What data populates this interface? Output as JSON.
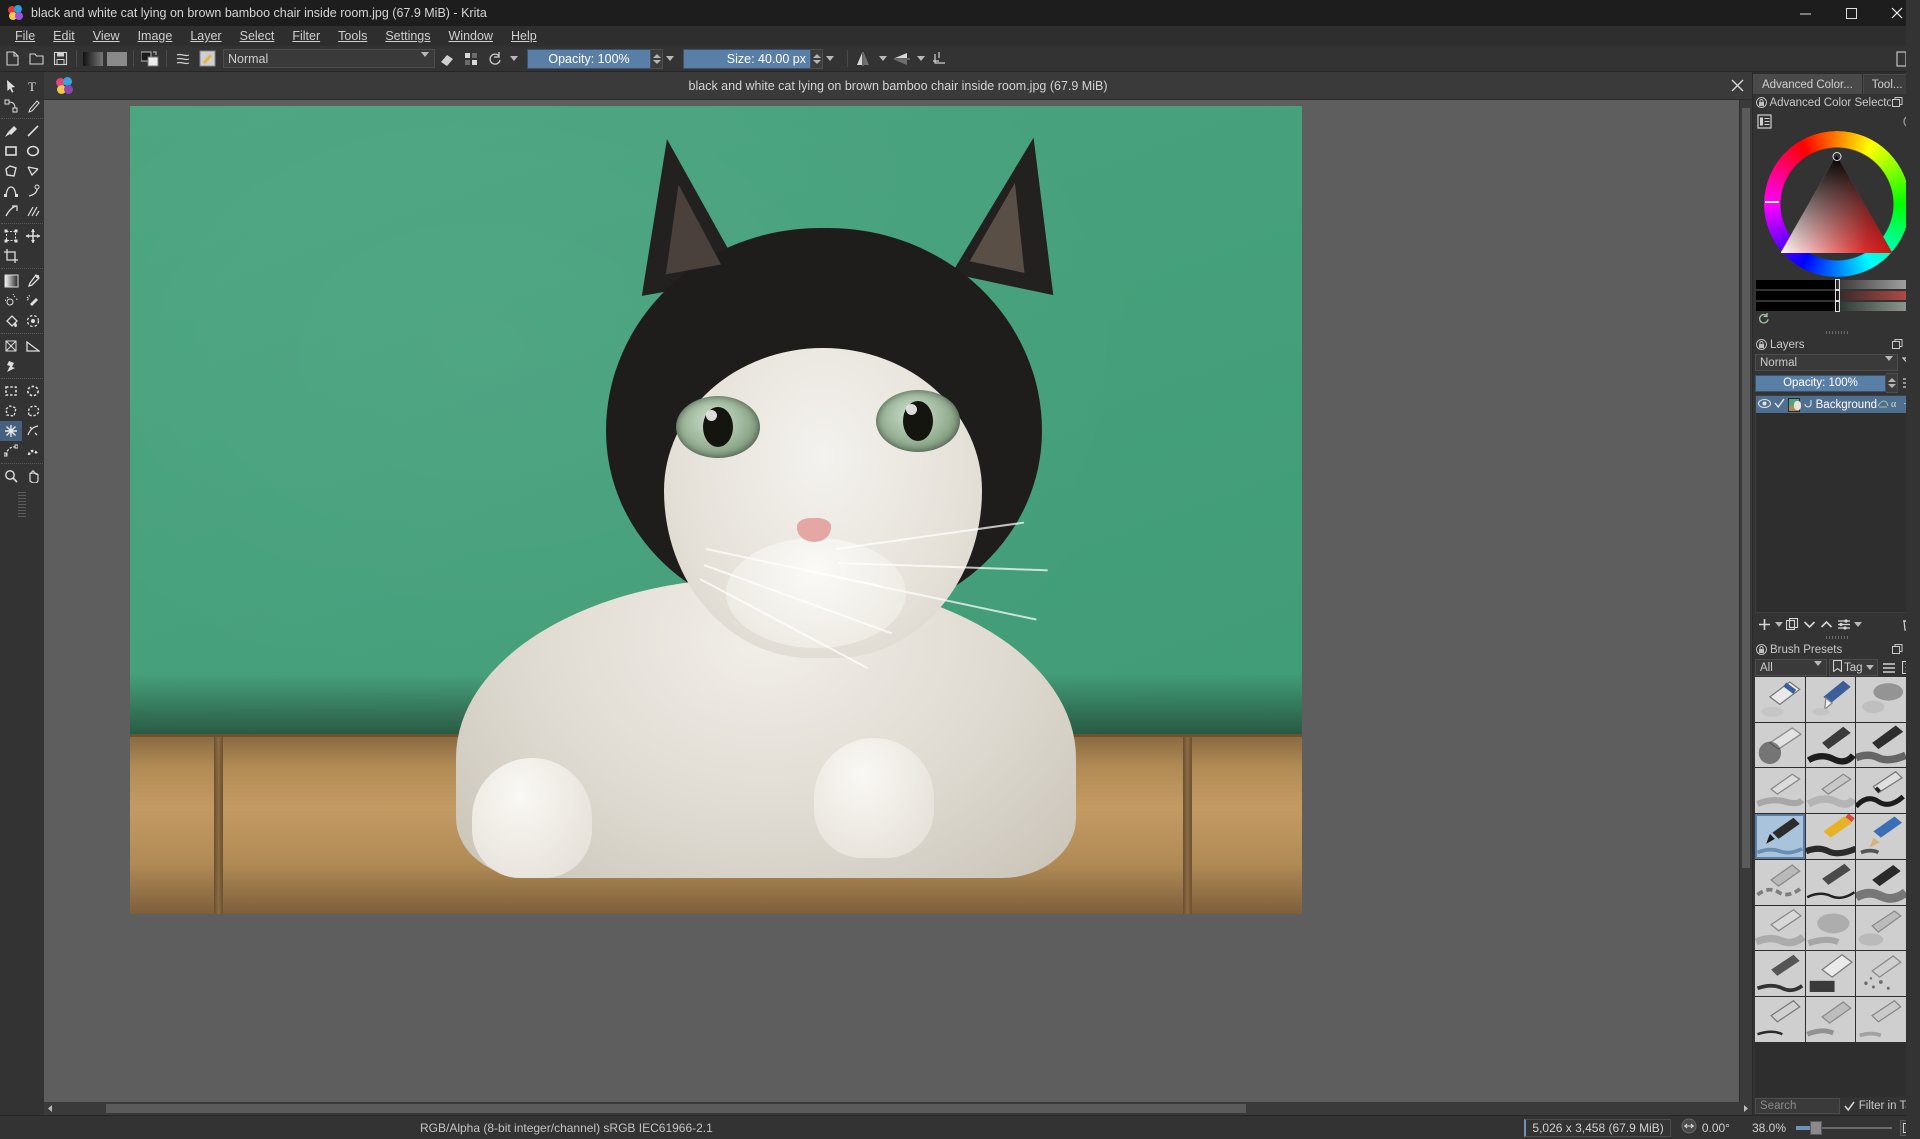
{
  "window": {
    "title": "black and white cat lying on brown bamboo chair inside room.jpg (67.9 MiB)  - Krita",
    "app_icon": "krita-logo-icon",
    "controls": {
      "minimize": "minimize-icon",
      "maximize": "maximize-icon",
      "close": "close-icon"
    }
  },
  "menubar": {
    "items": [
      {
        "label": "File"
      },
      {
        "label": "Edit"
      },
      {
        "label": "View"
      },
      {
        "label": "Image"
      },
      {
        "label": "Layer"
      },
      {
        "label": "Select"
      },
      {
        "label": "Filter"
      },
      {
        "label": "Tools"
      },
      {
        "label": "Settings"
      },
      {
        "label": "Window"
      },
      {
        "label": "Help"
      }
    ]
  },
  "toolbar": {
    "buttons": [
      {
        "name": "new-file-icon"
      },
      {
        "name": "open-file-icon"
      },
      {
        "name": "save-file-icon"
      },
      {
        "name": "gradient-icon"
      },
      {
        "name": "pattern-icon"
      },
      {
        "name": "fg-bg-color-icon"
      },
      {
        "name": "brush-editor-icon"
      },
      {
        "name": "brush-preset-icon"
      }
    ],
    "blending_mode": {
      "value": "Normal",
      "arrow": "chevron-down-icon"
    },
    "eraser_icon": "eraser-icon",
    "alpha_icon": "alpha-lock-icon",
    "reload_icon": "reload-preset-icon",
    "reload_arrow": "chevron-down-icon",
    "opacity": {
      "label": "Opacity:",
      "value": "100%",
      "display": "Opacity:  100%"
    },
    "size": {
      "label": "Size:",
      "value": "40.00 px",
      "display": "Size: 40.00 px"
    },
    "mirror_h_icon": "mirror-horizontal-icon",
    "mirror_v_icon": "mirror-vertical-icon",
    "wrap_icon": "wrap-around-icon",
    "workspace_icon": "workspace-chooser-icon"
  },
  "toolbox": {
    "tools": [
      {
        "name": "select-shapes-tool",
        "glyph": "cursor-arrow-icon",
        "active": false
      },
      {
        "name": "text-tool",
        "glyph": "text-icon",
        "active": false
      },
      {
        "name": "edit-shapes-tool",
        "glyph": "node-edit-icon",
        "active": false
      },
      {
        "name": "calligraphy-tool",
        "glyph": "calligraphy-pen-icon",
        "active": false
      },
      {
        "name": "freehand-brush-tool",
        "glyph": "paintbrush-icon",
        "active": false
      },
      {
        "name": "line-tool",
        "glyph": "line-icon",
        "active": false
      },
      {
        "name": "rectangle-tool",
        "glyph": "rectangle-icon",
        "active": false
      },
      {
        "name": "ellipse-tool",
        "glyph": "ellipse-icon",
        "active": false
      },
      {
        "name": "polygon-tool",
        "glyph": "polygon-icon",
        "active": false
      },
      {
        "name": "polyline-tool",
        "glyph": "polyline-icon",
        "active": false
      },
      {
        "name": "bezier-curve-tool",
        "glyph": "bezier-curve-icon",
        "active": false
      },
      {
        "name": "freehand-path-tool",
        "glyph": "freehand-path-icon",
        "active": false
      },
      {
        "name": "dynamic-brush-tool",
        "glyph": "dynamic-brush-icon",
        "active": false
      },
      {
        "name": "multibrush-tool",
        "glyph": "multibrush-icon",
        "active": false
      },
      {
        "name": "transform-tool",
        "glyph": "transform-icon",
        "active": false
      },
      {
        "name": "move-tool",
        "glyph": "move-icon",
        "active": false
      },
      {
        "name": "crop-tool",
        "glyph": "crop-icon",
        "active": false
      },
      {
        "name": "gradient-tool",
        "glyph": "gradient-tool-icon",
        "active": false
      },
      {
        "name": "color-picker-tool",
        "glyph": "eyedropper-icon",
        "active": false
      },
      {
        "name": "colorize-mask-tool",
        "glyph": "colorize-mask-icon",
        "active": false
      },
      {
        "name": "smart-patch-tool",
        "glyph": "smart-patch-icon",
        "active": false
      },
      {
        "name": "fill-tool",
        "glyph": "paint-bucket-icon",
        "active": false
      },
      {
        "name": "enclose-fill-tool",
        "glyph": "enclose-fill-icon",
        "active": false
      },
      {
        "name": "mesh-gradient-tool",
        "glyph": "mesh-gradient-icon",
        "active": false
      },
      {
        "name": "measure-tool",
        "glyph": "measure-triangle-icon",
        "active": false
      },
      {
        "name": "assistant-tool",
        "glyph": "assistant-pin-icon",
        "active": false
      },
      {
        "name": "rectangular-selection-tool",
        "glyph": "select-rectangle-icon",
        "active": false
      },
      {
        "name": "elliptical-selection-tool",
        "glyph": "select-ellipse-icon",
        "active": false
      },
      {
        "name": "polygonal-selection-tool",
        "glyph": "select-polygon-icon",
        "active": false
      },
      {
        "name": "freehand-selection-tool",
        "glyph": "select-freehand-icon",
        "active": false
      },
      {
        "name": "contiguous-selection-tool",
        "glyph": "select-contiguous-icon",
        "active": true
      },
      {
        "name": "similar-color-selection-tool",
        "glyph": "select-similar-icon",
        "active": false
      },
      {
        "name": "bezier-selection-tool",
        "glyph": "select-bezier-icon",
        "active": false
      },
      {
        "name": "magnetic-selection-tool",
        "glyph": "select-magnetic-icon",
        "active": false
      },
      {
        "name": "zoom-tool",
        "glyph": "magnifier-icon",
        "active": false
      },
      {
        "name": "pan-tool",
        "glyph": "hand-icon",
        "active": false
      }
    ]
  },
  "document": {
    "tab_title": "black and white cat lying on brown bamboo chair inside room.jpg (67.9 MiB)",
    "tab_icon": "krita-document-icon",
    "close_icon": "close-icon"
  },
  "right_dock": {
    "tabs": [
      {
        "label": "Advanced Color...",
        "active": true
      },
      {
        "label": "Tool...",
        "active": false
      }
    ],
    "color_selector": {
      "title": "Advanced Color Selector",
      "lock_icon": "dock-lock-icon",
      "float_icon": "float-dock-icon",
      "close_icon": "close-icon",
      "list_icon": "selector-settings-icon",
      "no_icon": "no-color-icon",
      "reset_icon": "reset-color-icon"
    },
    "layers": {
      "title": "Layers",
      "lock_icon": "dock-lock-icon",
      "float_icon": "float-dock-icon",
      "close_icon": "close-icon",
      "blend_mode": "Normal",
      "filter_icon": "layer-filter-icon",
      "opacity_display": "Opacity:  100%",
      "opacity_label": "Opacity:",
      "opacity_value": "100%",
      "properties_icon": "layer-properties-icon",
      "items": [
        {
          "name": "Background",
          "visible_icon": "eye-icon",
          "checkbox_icon": "check-icon",
          "thumbnail": "layer-thumbnail",
          "inherit_icon": "inherit-alpha-icon",
          "badges": [
            "onion-skin-icon",
            "alpha-icon",
            "filter-icon"
          ],
          "selected": true
        }
      ],
      "toolbar": [
        {
          "name": "add-layer-button",
          "glyph": "plus-icon"
        },
        {
          "name": "add-layer-dropdown",
          "glyph": "chevron-down-icon"
        },
        {
          "name": "duplicate-layer-button",
          "glyph": "duplicate-icon"
        },
        {
          "name": "move-layer-down-button",
          "glyph": "chevron-down-icon"
        },
        {
          "name": "move-layer-up-button",
          "glyph": "chevron-up-icon"
        },
        {
          "name": "layer-properties-button",
          "glyph": "sliders-icon"
        },
        {
          "name": "layer-properties-dropdown",
          "glyph": "chevron-down-icon"
        },
        {
          "name": "delete-layer-button",
          "glyph": "trash-icon"
        }
      ]
    },
    "brush_presets": {
      "title": "Brush Presets",
      "lock_icon": "dock-lock-icon",
      "float_icon": "float-dock-icon",
      "close_icon": "close-icon",
      "tag_filter": "All",
      "tag_button": "Tag",
      "tag_icon": "bookmark-icon",
      "tag_arrow": "chevron-down-icon",
      "list_view_icon": "list-view-icon",
      "detail_view_icon": "detail-view-icon",
      "search_placeholder": "Search",
      "filter_in_tag": {
        "label": "Filter in Tag",
        "checked": true
      },
      "scroll_up_icon": "chevron-up-icon",
      "scroll_down_icon": "chevron-down-icon",
      "grid": {
        "columns": 3,
        "rows": 8,
        "selected_index": 9,
        "cells": [
          "eraser-soft",
          "eraser-small",
          "airbrush-soft",
          "ink-bristle",
          "ink-gpen",
          "ink-brush-rough",
          "pencil-soft",
          "pencil-hard",
          "ink-tilt",
          "basic-wet-selected",
          "marker-chisel",
          "pencil-color",
          "sketch-rough",
          "ink-fineliner",
          "charcoal-soft",
          "bristle-wet",
          "blender-smudge",
          "airbrush-fine",
          "ink-pen-dry",
          "fill-block",
          "texture-speckle",
          "ink-sharp",
          "pencil-2b",
          "pen-detail"
        ]
      }
    }
  },
  "statusbar": {
    "color_profile": "RGB/Alpha (8-bit integer/channel)  sRGB IEC61966-2.1",
    "dimensions": "5,026 x 3,458 (67.9 MiB)",
    "rotation": "0.00°",
    "rotation_icon": "rotation-icon",
    "zoom": "38.0%",
    "fit_icon": "fit-page-icon"
  },
  "colors": {
    "accent": "#5a7fa6",
    "panel_bg": "#333333",
    "titlebar_bg": "#1d1d1d",
    "canvas_bg": "#5e5e5e",
    "wall_green": "#48a17d",
    "chair_brown": "#b08a55"
  }
}
